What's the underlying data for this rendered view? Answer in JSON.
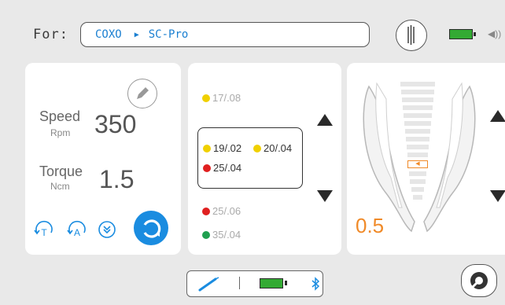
{
  "header": {
    "for_label": "For:",
    "brand": "COXO",
    "model": "SC-Pro",
    "separator": "▶"
  },
  "settings": {
    "speed_label": "Speed",
    "speed_value": "350",
    "speed_unit": "Rpm",
    "torque_label": "Torque",
    "torque_value": "1.5",
    "torque_unit": "Ncm"
  },
  "modes": {
    "t_label": "T",
    "a_label": "A"
  },
  "files": {
    "above": {
      "label": "17/.08",
      "color": "#f0d000"
    },
    "selected_row1": [
      {
        "label": "19/.02",
        "color": "#f0d000"
      },
      {
        "label": "20/.04",
        "color": "#f0d000"
      }
    ],
    "selected_row2": {
      "label": "25/.04",
      "color": "#e02020"
    },
    "below": [
      {
        "label": "25/.06",
        "color": "#e02020"
      },
      {
        "label": "35/.04",
        "color": "#20a050"
      }
    ]
  },
  "apex": {
    "value": "0.5",
    "value_color": "#f08a28"
  },
  "colors": {
    "accent_blue": "#1a8ce0",
    "battery_green": "#33aa33"
  }
}
